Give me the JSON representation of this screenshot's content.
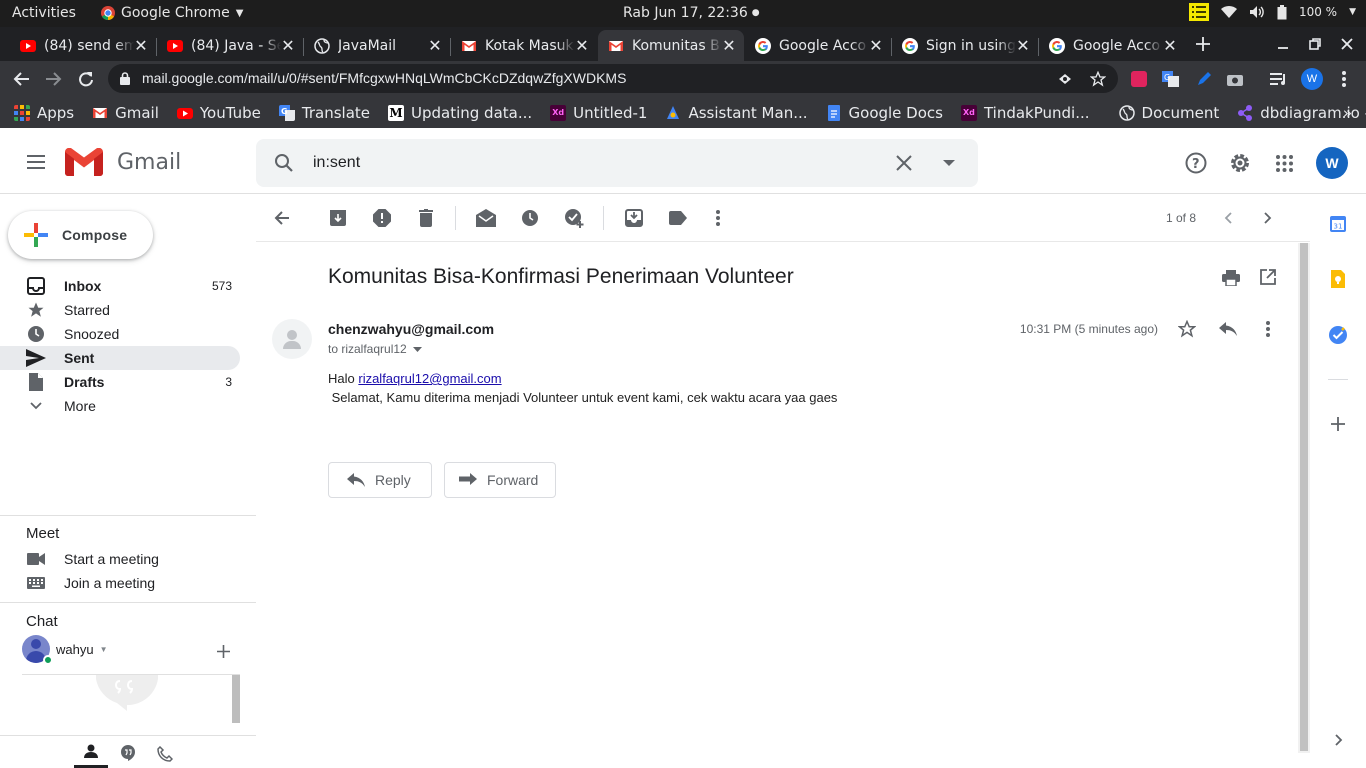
{
  "os": {
    "activities": "Activities",
    "app_name": "Google Chrome",
    "clock": "Rab Jun 17, 22:36",
    "battery": "100 %"
  },
  "tabs": [
    {
      "title": "(84) send em",
      "favicon": "youtube-icon"
    },
    {
      "title": "(84) Java - Se",
      "favicon": "youtube-icon"
    },
    {
      "title": "JavaMail",
      "favicon": "globe-icon"
    },
    {
      "title": "Kotak Masuk",
      "favicon": "gmail-icon"
    },
    {
      "title": "Komunitas B",
      "favicon": "gmail-icon"
    },
    {
      "title": "Google Acco",
      "favicon": "google-icon"
    },
    {
      "title": "Sign in using",
      "favicon": "google-icon"
    },
    {
      "title": "Google Acco",
      "favicon": "google-icon"
    }
  ],
  "address": {
    "url": "mail.google.com/mail/u/0/#sent/FMfcgxwHNqLWmCbCKcDZdqwZfgXWDKMS",
    "profile_initial": "W"
  },
  "bookmarks": [
    {
      "label": "Apps",
      "icon": "apps-grid-icon"
    },
    {
      "label": "Gmail",
      "icon": "gmail-icon"
    },
    {
      "label": "YouTube",
      "icon": "youtube-icon"
    },
    {
      "label": "Translate",
      "icon": "translate-icon"
    },
    {
      "label": "Updating data...",
      "icon": "medium-icon"
    },
    {
      "label": "Untitled-1",
      "icon": "xd-icon"
    },
    {
      "label": "Assistant Man...",
      "icon": "assistant-icon"
    },
    {
      "label": "Google Docs",
      "icon": "docs-icon"
    },
    {
      "label": "TindakPundi...",
      "icon": "xd-icon"
    },
    {
      "label": "Document",
      "icon": "globe-icon"
    },
    {
      "label": "dbdiagram.io -...",
      "icon": "dbdiagram-icon"
    }
  ],
  "gmail": {
    "logo_text": "Gmail",
    "search_query": "in:sent",
    "account_initial": "W",
    "compose_label": "Compose",
    "nav": [
      {
        "label": "Inbox",
        "count": "573"
      },
      {
        "label": "Starred",
        "count": ""
      },
      {
        "label": "Snoozed",
        "count": ""
      },
      {
        "label": "Sent",
        "count": ""
      },
      {
        "label": "Drafts",
        "count": "3"
      },
      {
        "label": "More",
        "count": ""
      }
    ],
    "meet": {
      "title": "Meet",
      "start": "Start a meeting",
      "join": "Join a meeting"
    },
    "chat": {
      "title": "Chat",
      "user": "wahyu"
    },
    "pagination": "1 of 8"
  },
  "message": {
    "subject": "Komunitas Bisa-Konfirmasi Penerimaan Volunteer",
    "sender": "chenzwahyu@gmail.com",
    "to": "to rizalfaqrul12",
    "time": "10:31 PM (5 minutes ago)",
    "greeting": "Halo ",
    "recipient_link": "rizalfaqrul12@gmail.com",
    "body_line": " Selamat, Kamu diterima menjadi Volunteer untuk event kami, cek waktu acara yaa gaes",
    "reply_label": "Reply",
    "forward_label": "Forward"
  }
}
